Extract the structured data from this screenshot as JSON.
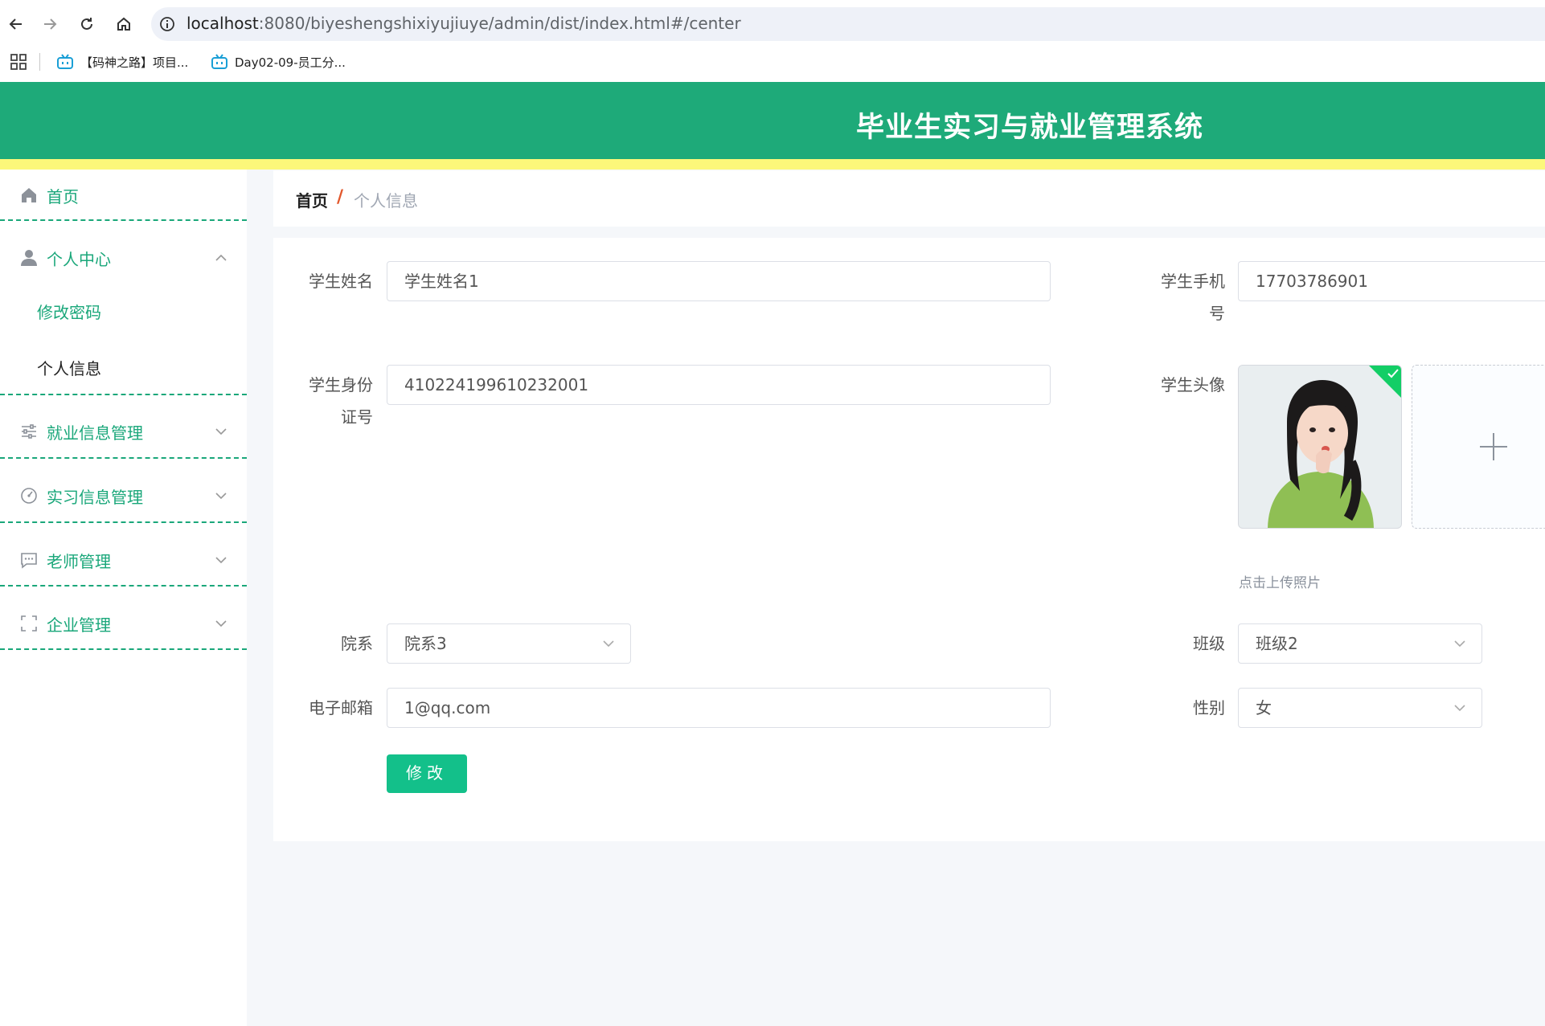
{
  "browser": {
    "url_host": "localhost",
    "url_rest": ":8080/biyeshengshixiyujiuye/admin/dist/index.html#/center",
    "bookmarks": [
      "【码神之路】项目...",
      "Day02-09-员工分..."
    ]
  },
  "header": {
    "title": "毕业生实习与就业管理系统"
  },
  "sidebar": {
    "home": "首页",
    "personal_center": "个人中心",
    "change_password": "修改密码",
    "personal_info": "个人信息",
    "job_info": "就业信息管理",
    "intern_info": "实习信息管理",
    "teacher": "老师管理",
    "company": "企业管理"
  },
  "breadcrumb": {
    "home": "首页",
    "separator": "/",
    "current": "个人信息"
  },
  "form": {
    "name_label": "学生姓名",
    "name_value": "学生姓名1",
    "phone_label_1": "学生手机",
    "phone_label_2": "号",
    "phone_value": "17703786901",
    "id_label_1": "学生身份",
    "id_label_2": "证号",
    "id_value": "410224199610232001",
    "avatar_label": "学生头像",
    "upload_tip": "点击上传照片",
    "dept_label": "院系",
    "dept_value": "院系3",
    "class_label": "班级",
    "class_value": "班级2",
    "email_label": "电子邮箱",
    "email_value": "1@qq.com",
    "gender_label": "性别",
    "gender_value": "女",
    "submit_label": "修改"
  },
  "colors": {
    "primary": "#1eaa79",
    "stripe": "#fcf77a",
    "button": "#13c08a",
    "breadcrumb_sep": "#e2582d"
  }
}
